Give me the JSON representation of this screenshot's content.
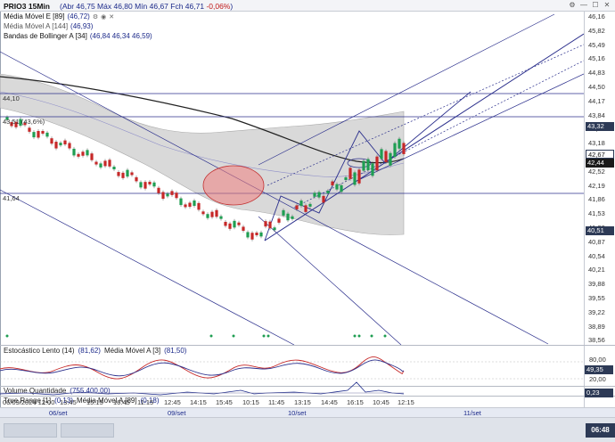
{
  "header": {
    "symbol": "PRIO3 15Min",
    "quote_prefix": "(Abr 46,75 Máx 46,80 Mín 46,67 Fch 46,71 ",
    "quote_change": "-0,06%",
    "quote_suffix": ")"
  },
  "legends": {
    "mme": {
      "name": "Média Móvel E [89]",
      "value": "(46,72)"
    },
    "mma": {
      "name": "Média Móvel A [144]",
      "value": "(46,93)"
    },
    "bollinger": {
      "name": "Bandas de Bollinger A [34]",
      "value": "(46,84  46,34  46,59)"
    }
  },
  "price_axis": {
    "ticks": [
      "46,16",
      "45,82",
      "45,49",
      "45,16",
      "44,83",
      "44,50",
      "44,17",
      "43,84",
      "43,51",
      "43,18",
      "42,85",
      "42,52",
      "42,19",
      "41,86",
      "41,53",
      "41,20",
      "40,87",
      "40,54",
      "40,21",
      "39,88",
      "39,55",
      "39,22",
      "38,89",
      "38,56"
    ],
    "badges": [
      {
        "text": "43,32",
        "color": "#2d3a56"
      },
      {
        "text": "42,67",
        "color": "#ffffff"
      },
      {
        "text": "42,44",
        "color": "#1a1a1a"
      },
      {
        "text": "40,51",
        "color": "#2d3a56"
      }
    ]
  },
  "hline_labels": [
    "44,10",
    "43,51  (43,6%)",
    "41,64"
  ],
  "stochastic": {
    "title": "Estocástico Lento (14)",
    "value": "(81,62)",
    "ma_title": "Média Móvel A [3]",
    "ma_value": "(81,50)",
    "ticks": [
      "80,00",
      "20,00"
    ],
    "badge": "49,35"
  },
  "volume": {
    "title": "Volume Quantidade",
    "value": "(755.400,00)"
  },
  "true_range": {
    "title": "True Range [1]",
    "value": "(0,13)",
    "ma_title": "Média Móvel A [89]",
    "ma_value": "(0,18)",
    "badge": "0,23"
  },
  "time_axis": [
    "06/09/2024 12:00",
    "13:45",
    "15:15",
    "16:45",
    "11:15",
    "12:45",
    "14:15",
    "15:45",
    "10:15",
    "11:45",
    "13:15",
    "14:45",
    "16:15",
    "10:45",
    "12:15"
  ],
  "date_axis": [
    "06/set",
    "09/set",
    "10/set",
    "11/set"
  ],
  "taskbar": {
    "clock": "06:48"
  },
  "colors": {
    "bull": "#1f9e52",
    "bear": "#c62828",
    "line_blue": "#2b2f8c",
    "band_fill": "#cfcfcf",
    "highlight": "#f08080"
  }
}
